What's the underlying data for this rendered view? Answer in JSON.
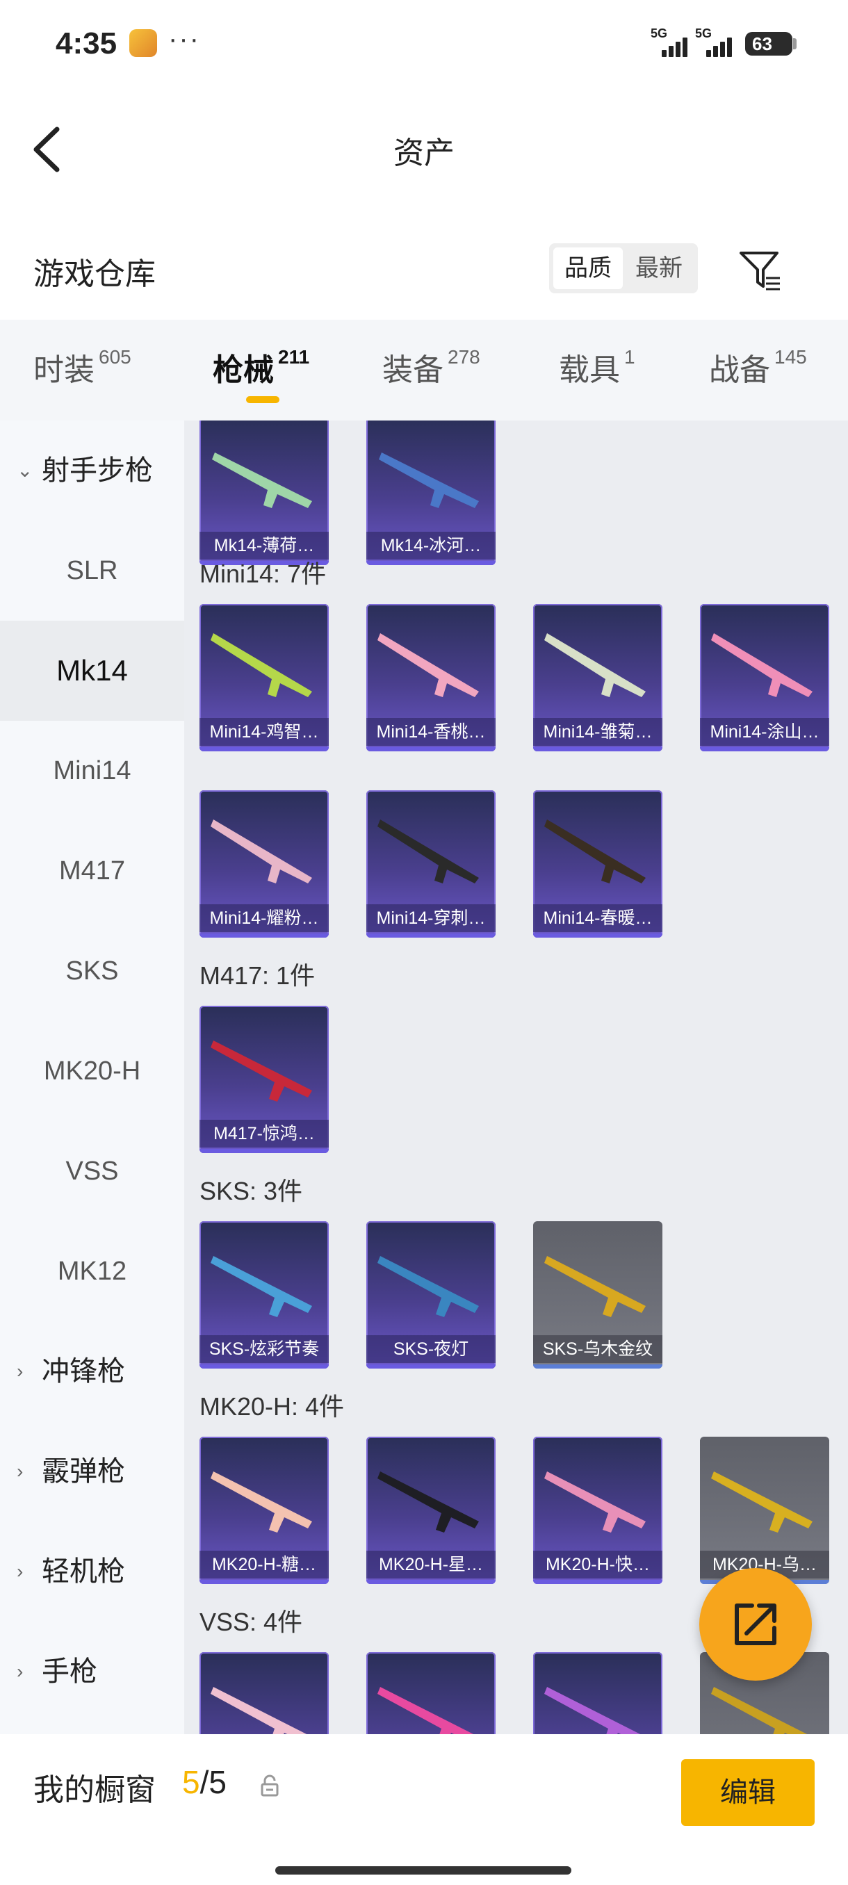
{
  "status": {
    "time": "4:35",
    "dots": "···",
    "signal1": "5G",
    "signal2": "5G",
    "battery": "63"
  },
  "header": {
    "title": "资产"
  },
  "warehouse": {
    "title": "游戏仓库",
    "sort_options": [
      "品质",
      "最新"
    ],
    "sort_selected": "品质"
  },
  "tabs": [
    {
      "label": "时装",
      "count": "605"
    },
    {
      "label": "枪械",
      "count": "211"
    },
    {
      "label": "装备",
      "count": "278"
    },
    {
      "label": "载具",
      "count": "1"
    },
    {
      "label": "战备",
      "count": "145"
    }
  ],
  "active_tab": "枪械",
  "sidebar": {
    "group_open": "射手步枪",
    "items": [
      "SLR",
      "Mk14",
      "Mini14",
      "M417",
      "SKS",
      "MK20-H",
      "VSS",
      "MK12"
    ],
    "active_item": "Mk14",
    "groups": [
      "冲锋枪",
      "霰弹枪",
      "轻机枪",
      "手枪"
    ]
  },
  "content": {
    "mk14_items": [
      "Mk14-薄荷…",
      "Mk14-冰河…"
    ],
    "mini14_label": "Mini14: 7件",
    "mini14_items": [
      "Mini14-鸡智…",
      "Mini14-香桃…",
      "Mini14-雏菊…",
      "Mini14-涂山…",
      "Mini14-耀粉…",
      "Mini14-穿刺…",
      "Mini14-春暖…"
    ],
    "m417_label": "M417: 1件",
    "m417_items": [
      "M417-惊鸿…"
    ],
    "sks_label": "SKS: 3件",
    "sks_items": [
      "SKS-炫彩节奏",
      "SKS-夜灯",
      "SKS-乌木金纹"
    ],
    "mk20_label": "MK20-H: 4件",
    "mk20_items": [
      "MK20-H-糖…",
      "MK20-H-星…",
      "MK20-H-快…",
      "MK20-H-乌…"
    ],
    "vss_label": "VSS: 4件"
  },
  "bottom": {
    "showcase_label": "我的橱窗",
    "showcase_current": "5",
    "showcase_sep_total": "/5",
    "edit_label": "编辑"
  },
  "colors": {
    "accent": "#f7b500",
    "fab": "#f7a51c",
    "card_purple": "#4a3f8e",
    "card_gray": "#6e7079"
  }
}
